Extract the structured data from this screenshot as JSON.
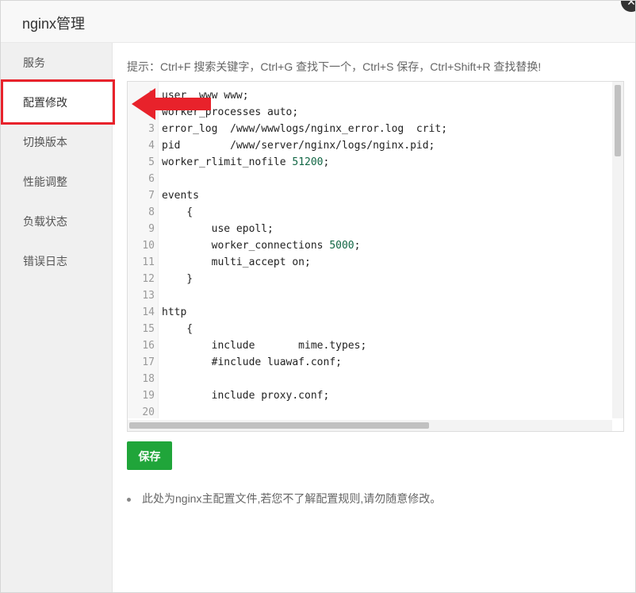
{
  "window": {
    "title": "nginx管理"
  },
  "sidebar": {
    "items": [
      {
        "label": "服务"
      },
      {
        "label": "配置修改"
      },
      {
        "label": "切换版本"
      },
      {
        "label": "性能调整"
      },
      {
        "label": "负载状态"
      },
      {
        "label": "错误日志"
      }
    ],
    "active_index": 1
  },
  "editor": {
    "tip": "提示：Ctrl+F 搜索关键字，Ctrl+G 查找下一个，Ctrl+S 保存，Ctrl+Shift+R 查找替换!",
    "lines": [
      {
        "n": "1",
        "text": "user  www www;"
      },
      {
        "n": "2",
        "text": "worker_processes auto;"
      },
      {
        "n": "3",
        "text": "error_log  /www/wwwlogs/nginx_error.log  crit;"
      },
      {
        "n": "4",
        "text": "pid        /www/server/nginx/logs/nginx.pid;"
      },
      {
        "n": "5",
        "text": "worker_rlimit_nofile ",
        "num": "51200",
        "after": ";"
      },
      {
        "n": "6",
        "text": ""
      },
      {
        "n": "7",
        "text": "events"
      },
      {
        "n": "8",
        "text": "    {"
      },
      {
        "n": "9",
        "text": "        use epoll;"
      },
      {
        "n": "10",
        "text": "        worker_connections ",
        "num": "5000",
        "after": ";"
      },
      {
        "n": "11",
        "text": "        multi_accept on;"
      },
      {
        "n": "12",
        "text": "    }"
      },
      {
        "n": "13",
        "text": ""
      },
      {
        "n": "14",
        "text": "http"
      },
      {
        "n": "15",
        "text": "    {"
      },
      {
        "n": "16",
        "text": "        include       mime.types;"
      },
      {
        "n": "17",
        "text": "        #include luawaf.conf;"
      },
      {
        "n": "18",
        "text": ""
      },
      {
        "n": "19",
        "text": "        include proxy.conf;"
      },
      {
        "n": "20",
        "text": ""
      }
    ]
  },
  "actions": {
    "save_label": "保存"
  },
  "notes": [
    "此处为nginx主配置文件,若您不了解配置规则,请勿随意修改。"
  ],
  "colors": {
    "accent": "#20a53a",
    "annotation": "#e8222b"
  },
  "icons": {
    "close": "close-icon",
    "annotation_arrow": "red-arrow-icon"
  }
}
